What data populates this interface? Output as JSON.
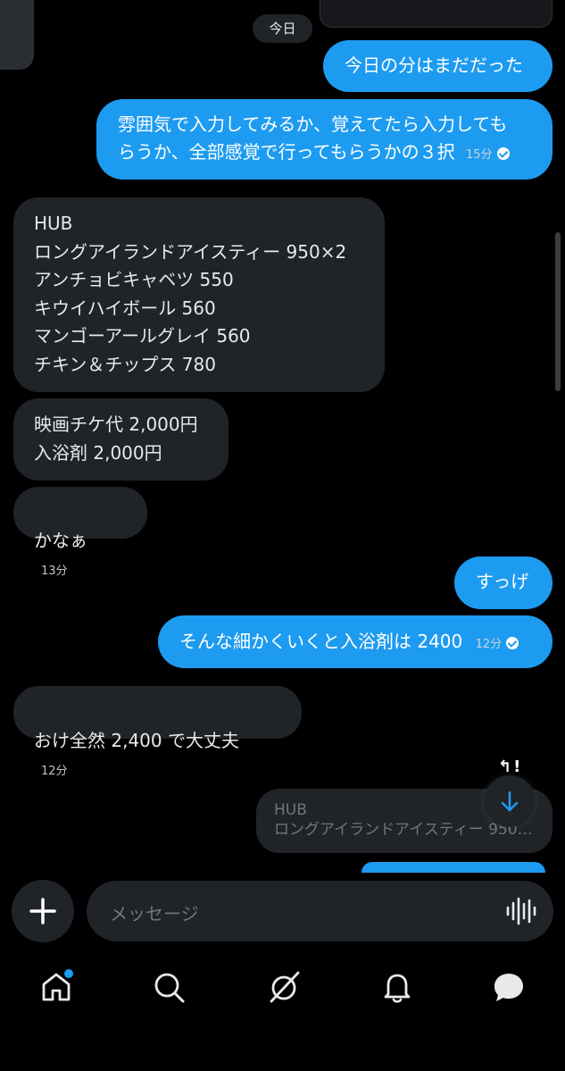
{
  "date_chip": "今日",
  "messages": {
    "out1": "今日の分はまだだった",
    "out2_line1": "雰囲気で入力してみるか、覚えてたら入力しても",
    "out2_line2": "らうか、全部感覚で行ってもらうかの３択",
    "out2_time": "15分",
    "in1": "HUB\nロングアイランドアイスティー 950×2\nアンチョビキャベツ 550\nキウイハイボール 560\nマンゴーアールグレイ 560\nチキン＆チップス 780",
    "in2": "映画チケ代 2,000円\n入浴剤 2,000円",
    "in3": "かなぁ",
    "in3_time": "13分",
    "out3": "すっげ",
    "out4": "そんな細かくいくと入浴剤は 2400",
    "out4_time": "12分",
    "in4": "おけ全然 2,400 で大丈夫",
    "in4_time": "12分",
    "reply_preview_line1": "HUB",
    "reply_preview_line2": "ロングアイランドアイスティー 950…"
  },
  "composer": {
    "placeholder": "メッセージ"
  },
  "icons": {
    "add": "plus-icon",
    "voice": "voice-wave-icon",
    "scroll_down": "arrow-down-icon",
    "nav": [
      "home-icon",
      "search-icon",
      "grok-icon",
      "bell-icon",
      "messages-icon"
    ]
  },
  "colors": {
    "accent": "#1d9bf0",
    "incoming_bubble": "#202327",
    "background": "#000000"
  }
}
